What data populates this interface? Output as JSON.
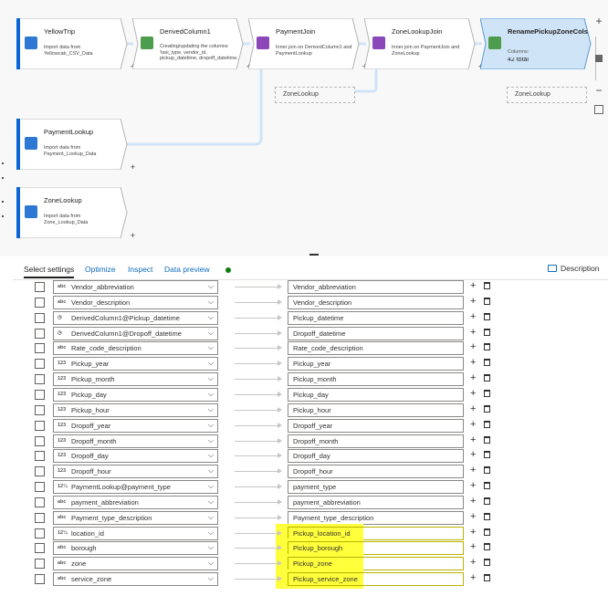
{
  "colors": {
    "highlight": "#ffff3b",
    "accent": "#0f6cbd",
    "node_selected": "#cfe4f7",
    "connector": "#cfe4f7"
  },
  "canvas": {
    "nodes": [
      {
        "id": "yellowtrip",
        "title": "YellowTrip",
        "desc": "Import data from Yellowcab_CSV_Data",
        "icon": "source-icon"
      },
      {
        "id": "derived",
        "title": "DerivedColumn1",
        "desc": "Creating/updating the columns 'taxi_type, vendor_id, pickup_datetime, dropoff_datetime,",
        "icon": "derived-column-icon"
      },
      {
        "id": "paymentjoin",
        "title": "PaymentJoin",
        "desc": "Inner join on DerivedColumn1 and PaymentLookup",
        "icon": "join-icon"
      },
      {
        "id": "zonelookupjoin",
        "title": "ZoneLookupJoin",
        "desc": "Inner join on PaymentJoin and ZoneLookup",
        "icon": "join-icon"
      },
      {
        "id": "rename",
        "title": "RenamePickupZoneCols",
        "desc_label": "Columns:",
        "desc": "42 total",
        "icon": "select-icon"
      },
      {
        "id": "paymentlookup",
        "title": "PaymentLookup",
        "desc": "Import data from Payment_Lookup_Data",
        "icon": "source-icon"
      },
      {
        "id": "zonelookup",
        "title": "ZoneLookup",
        "desc": "Import data from Zone_Lookup_Data",
        "icon": "source-icon"
      }
    ],
    "ghosts": [
      "ZoneLookup",
      "ZoneLookup"
    ],
    "zoom": {
      "in": "+",
      "out": "−"
    }
  },
  "tabs": {
    "items": [
      "Select settings",
      "Optimize",
      "Inspect",
      "Data preview"
    ],
    "description": "Description"
  },
  "mappings": [
    {
      "type": "abc",
      "source": "Vendor_abbreviation",
      "target": "Vendor_abbreviation",
      "highlight": false
    },
    {
      "type": "abc",
      "source": "Vendor_description",
      "target": "Vendor_description",
      "highlight": false
    },
    {
      "type": "◷",
      "source": "DerivedColumn1@Pickup_datetime",
      "target": "Pickup_datetime",
      "highlight": false
    },
    {
      "type": "◷",
      "source": "DerivedColumn1@Dropoff_datetime",
      "target": "Dropoff_datetime",
      "highlight": false
    },
    {
      "type": "abc",
      "source": "Rate_code_description",
      "target": "Rate_code_description",
      "highlight": false
    },
    {
      "type": "123",
      "source": "Pickup_year",
      "target": "Pickup_year",
      "highlight": false
    },
    {
      "type": "123",
      "source": "Pickup_month",
      "target": "Pickup_month",
      "highlight": false
    },
    {
      "type": "123",
      "source": "Pickup_day",
      "target": "Pickup_day",
      "highlight": false
    },
    {
      "type": "123",
      "source": "Pickup_hour",
      "target": "Pickup_hour",
      "highlight": false
    },
    {
      "type": "123",
      "source": "Dropoff_year",
      "target": "Dropoff_year",
      "highlight": false
    },
    {
      "type": "123",
      "source": "Dropoff_month",
      "target": "Dropoff_month",
      "highlight": false
    },
    {
      "type": "123",
      "source": "Dropoff_day",
      "target": "Dropoff_day",
      "highlight": false
    },
    {
      "type": "123",
      "source": "Dropoff_hour",
      "target": "Dropoff_hour",
      "highlight": false
    },
    {
      "type": "12¼",
      "source": "PaymentLookup@payment_type",
      "target": "payment_type",
      "highlight": false
    },
    {
      "type": "abc",
      "source": "payment_abbreviation",
      "target": "payment_abbreviation",
      "highlight": false
    },
    {
      "type": "abc",
      "source": "Payment_type_description",
      "target": "Payment_type_description",
      "highlight": false
    },
    {
      "type": "12¼",
      "source": "location_id",
      "target": "Pickup_location_id",
      "highlight": true
    },
    {
      "type": "abc",
      "source": "borough",
      "target": "Pickup_borough",
      "highlight": true
    },
    {
      "type": "abc",
      "source": "zone",
      "target": "Pickup_zone",
      "highlight": true
    },
    {
      "type": "abc",
      "source": "service_zone",
      "target": "Pickup_service_zone",
      "highlight": true
    }
  ]
}
